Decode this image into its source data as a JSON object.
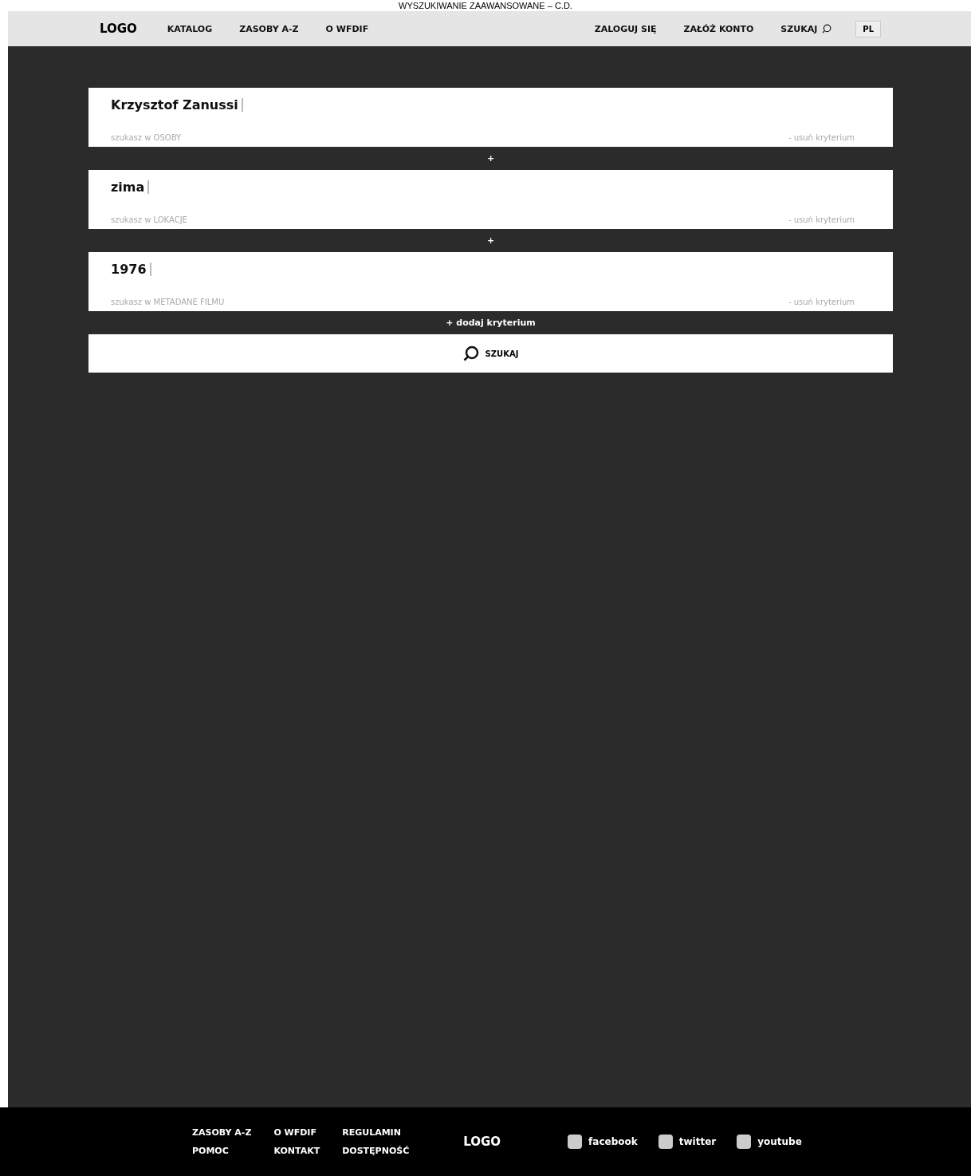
{
  "page_caption": "WYSZUKIWANIE ZAAWANSOWANE – C.D.",
  "header": {
    "logo": "LOGO",
    "nav": [
      "KATALOG",
      "ZASOBY A-Z",
      "O WFDIF"
    ],
    "account": [
      "ZALOGUJ SIĘ",
      "ZAŁÓŻ KONTO"
    ],
    "search": "SZUKAJ",
    "language": "PL"
  },
  "criteria": [
    {
      "value": "Krzysztof Zanussi",
      "scope": "szukasz w OSOBY",
      "remove": "- usuń kryterium",
      "joiner": "+"
    },
    {
      "value": "zima",
      "scope": "szukasz w LOKACJE",
      "remove": "- usuń kryterium",
      "joiner": "+"
    },
    {
      "value": "1976",
      "scope": "szukasz w METADANE FILMU",
      "remove": "- usuń kryterium"
    }
  ],
  "add_criterion": "+ dodaj kryterium",
  "search_button": "SZUKAJ",
  "footer": {
    "columns": [
      [
        "ZASOBY A-Z",
        "POMOC"
      ],
      [
        "O WFDIF",
        "KONTAKT"
      ],
      [
        "REGULAMIN",
        "DOSTĘPNOŚĆ"
      ]
    ],
    "logo": "LOGO",
    "social": [
      "facebook",
      "twitter",
      "youtube"
    ]
  }
}
